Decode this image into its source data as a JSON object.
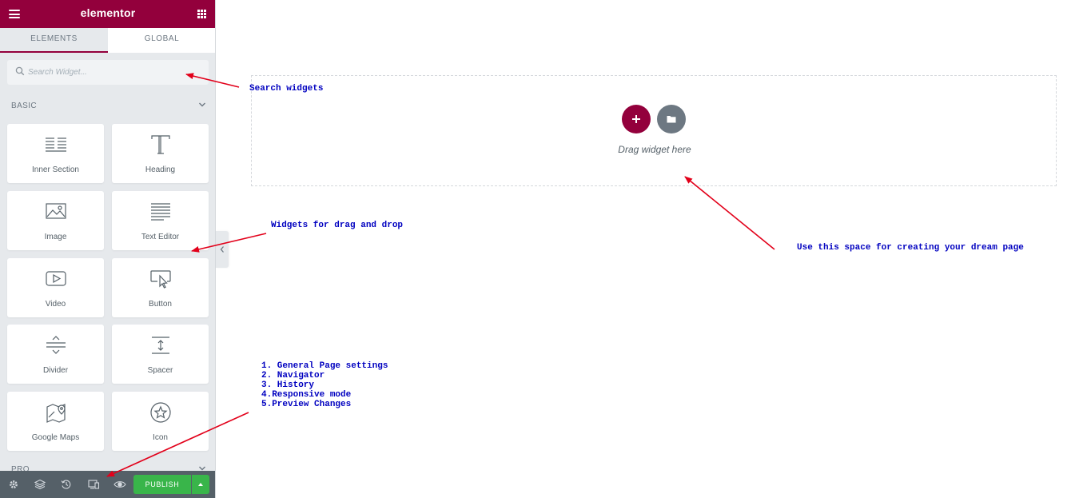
{
  "panel": {
    "brand": "elementor",
    "tabs": [
      {
        "label": "ELEMENTS",
        "active": true
      },
      {
        "label": "GLOBAL",
        "active": false
      }
    ],
    "search": {
      "placeholder": "Search Widget..."
    },
    "section_title": "BASIC",
    "widgets": [
      {
        "label": "Inner Section",
        "icon": "inner-section-icon"
      },
      {
        "label": "Heading",
        "icon": "heading-icon"
      },
      {
        "label": "Image",
        "icon": "image-icon"
      },
      {
        "label": "Text Editor",
        "icon": "text-editor-icon"
      },
      {
        "label": "Video",
        "icon": "video-icon"
      },
      {
        "label": "Button",
        "icon": "button-icon"
      },
      {
        "label": "Divider",
        "icon": "divider-icon"
      },
      {
        "label": "Spacer",
        "icon": "spacer-icon"
      },
      {
        "label": "Google Maps",
        "icon": "google-maps-icon"
      },
      {
        "label": "Icon",
        "icon": "star-icon"
      }
    ],
    "next_section_title": "PRO"
  },
  "footer": {
    "buttons": [
      "settings-icon",
      "navigator-icon",
      "history-icon",
      "responsive-icon",
      "preview-icon"
    ],
    "publish_label": "PUBLISH"
  },
  "canvas": {
    "drag_text": "Drag widget here"
  },
  "annotations": {
    "search": "Search widgets",
    "widgets": "Widgets for drag and drop",
    "canvas": "Use this space for creating your dream page",
    "footer": "1. General Page settings\n2. Navigator\n3. History\n4.Responsive mode\n5.Preview Changes"
  },
  "colors": {
    "brand": "#93003c",
    "panel_bg": "#e6e9ec",
    "publish": "#39b54a",
    "footer_bg": "#556068",
    "annotation_text": "#0000c0",
    "arrow": "#e2001a"
  }
}
